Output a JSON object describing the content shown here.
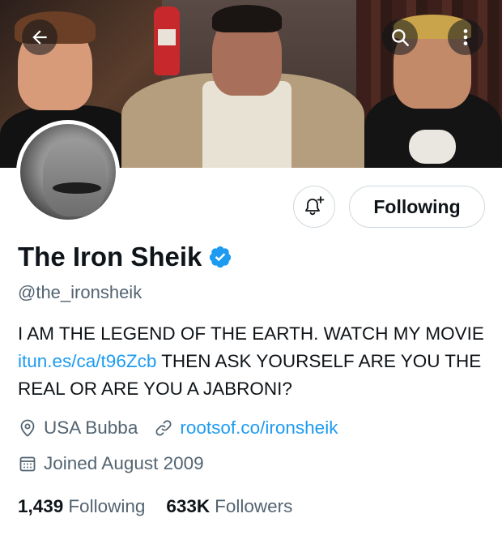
{
  "header": {
    "back_icon": "arrow-left-icon",
    "search_icon": "search-icon",
    "more_icon": "more-vertical-icon"
  },
  "profile": {
    "display_name": "The Iron Sheik",
    "handle": "@the_ironsheik",
    "verified_icon": "verified-badge-icon",
    "verified_color": "#1d9bf0"
  },
  "actions": {
    "notify_icon": "bell-plus-icon",
    "following_label": "Following"
  },
  "bio": {
    "part1": "I AM THE LEGEND OF THE EARTH. WATCH MY MOVIE ",
    "link": "itun.es/ca/t96Zcb",
    "part2": " THEN ASK YOURSELF ARE YOU THE REAL OR ARE YOU A JABRONI?"
  },
  "meta": {
    "location": "USA Bubba",
    "location_icon": "location-pin-icon",
    "website": "rootsof.co/ironsheik",
    "website_icon": "link-icon",
    "joined": "Joined August 2009",
    "joined_icon": "calendar-icon"
  },
  "stats": {
    "following_count": "1,439",
    "following_label": "Following",
    "followers_count": "633K",
    "followers_label": "Followers"
  },
  "colors": {
    "link": "#1d9bf0",
    "secondary_text": "#536471",
    "primary_text": "#0f1419"
  }
}
